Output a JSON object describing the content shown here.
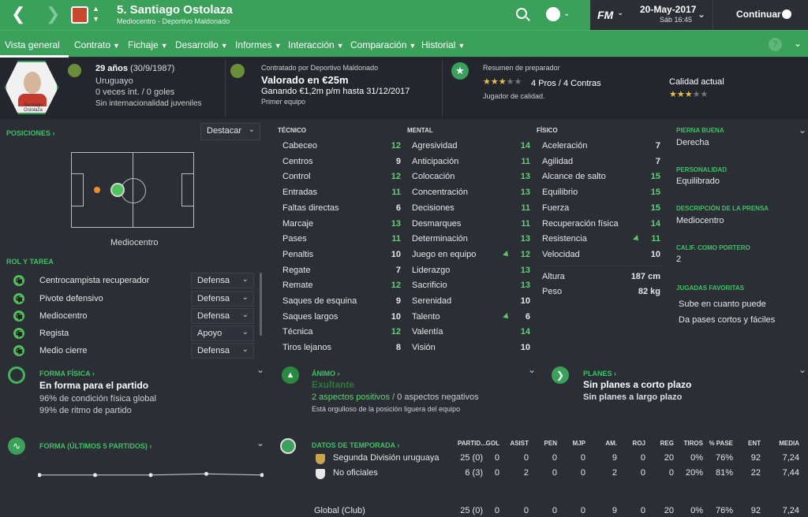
{
  "topbar": {
    "title": "5. Santiago Ostolaza",
    "subtitle": "Mediocentro - Deportivo Maldonado",
    "date": "20-May-2017",
    "day_time": "Sáb 16:45",
    "continue_label": "Continuar",
    "fm_logo": "FM"
  },
  "nav": {
    "items": [
      "Vista general",
      "Contrato",
      "Fichaje",
      "Desarrollo",
      "Informes",
      "Interacción",
      "Comparación",
      "Historial"
    ]
  },
  "profile": {
    "card_name": "Santiago\nOstolaza",
    "age": "29 años",
    "dob": "(30/9/1987)",
    "nationality": "Uruguayo",
    "caps": "0 veces int. / 0 goles",
    "youth": "Sin internacionalidad juveniles"
  },
  "contract": {
    "signed_by": "Contratado por Deportivo Maldonado",
    "value": "Valorado en €25m",
    "wage": "Ganando €1,2m p/m hasta 31/12/2017",
    "squad": "Primer equipo"
  },
  "coach": {
    "title": "Resumen de preparador",
    "pros_cons": "4 Pros / 4 Contras",
    "quality": "Jugador de calidad.",
    "current_quality_label": "Calidad actual",
    "stars_filled": 3,
    "stars_total": 5
  },
  "positions": {
    "label": "POSICIONES",
    "highlight_label": "Destacar",
    "position_name": "Mediocentro"
  },
  "roles": {
    "label": "ROL Y TAREA",
    "items": [
      {
        "role": "Centrocampista recuperador",
        "duty": "Defensa"
      },
      {
        "role": "Pivote defensivo",
        "duty": "Defensa"
      },
      {
        "role": "Mediocentro",
        "duty": "Defensa"
      },
      {
        "role": "Regista",
        "duty": "Apoyo"
      },
      {
        "role": "Medio cierre",
        "duty": "Defensa"
      }
    ]
  },
  "attributes": {
    "technical_label": "TÉCNICO",
    "mental_label": "MENTAL",
    "physical_label": "FÍSICO",
    "technical": [
      {
        "name": "Cabeceo",
        "value": "12",
        "hi": true
      },
      {
        "name": "Centros",
        "value": "9"
      },
      {
        "name": "Control",
        "value": "12",
        "hi": true
      },
      {
        "name": "Entradas",
        "value": "11",
        "hi": true
      },
      {
        "name": "Faltas directas",
        "value": "6"
      },
      {
        "name": "Marcaje",
        "value": "13",
        "hi": true
      },
      {
        "name": "Pases",
        "value": "11",
        "hi": true
      },
      {
        "name": "Penaltis",
        "value": "10"
      },
      {
        "name": "Regate",
        "value": "7"
      },
      {
        "name": "Remate",
        "value": "12",
        "hi": true
      },
      {
        "name": "Saques de esquina",
        "value": "9"
      },
      {
        "name": "Saques largos",
        "value": "10"
      },
      {
        "name": "Técnica",
        "value": "12",
        "hi": true
      },
      {
        "name": "Tiros lejanos",
        "value": "8"
      }
    ],
    "mental": [
      {
        "name": "Agresividad",
        "value": "14",
        "hi": true
      },
      {
        "name": "Anticipación",
        "value": "11",
        "hi": true
      },
      {
        "name": "Colocación",
        "value": "13",
        "hi": true
      },
      {
        "name": "Concentración",
        "value": "13",
        "hi": true
      },
      {
        "name": "Decisiones",
        "value": "11",
        "hi": true
      },
      {
        "name": "Desmarques",
        "value": "11",
        "hi": true
      },
      {
        "name": "Determinación",
        "value": "13",
        "hi": true
      },
      {
        "name": "Juego en equipo",
        "value": "12",
        "hi": true,
        "arrow": true
      },
      {
        "name": "Liderazgo",
        "value": "13",
        "hi": true
      },
      {
        "name": "Sacrificio",
        "value": "13",
        "hi": true
      },
      {
        "name": "Serenidad",
        "value": "10"
      },
      {
        "name": "Talento",
        "value": "6",
        "arrow": true
      },
      {
        "name": "Valentía",
        "value": "14",
        "hi": true
      },
      {
        "name": "Visión",
        "value": "10"
      }
    ],
    "physical": [
      {
        "name": "Aceleración",
        "value": "7"
      },
      {
        "name": "Agilidad",
        "value": "7"
      },
      {
        "name": "Alcance de salto",
        "value": "15",
        "hi": true
      },
      {
        "name": "Equilibrio",
        "value": "15",
        "hi": true
      },
      {
        "name": "Fuerza",
        "value": "15",
        "hi": true
      },
      {
        "name": "Recuperación física",
        "value": "14",
        "hi": true
      },
      {
        "name": "Resistencia",
        "value": "11",
        "hi": true,
        "arrow": true
      },
      {
        "name": "Velocidad",
        "value": "10"
      }
    ],
    "height_label": "Altura",
    "height": "187 cm",
    "weight_label": "Peso",
    "weight": "82 kg"
  },
  "side": {
    "foot_label": "PIERNA BUENA",
    "foot": "Derecha",
    "personality_label": "PERSONALIDAD",
    "personality": "Equilibrado",
    "press_label": "DESCRIPCIÓN DE LA PRENSA",
    "press": "Mediocentro",
    "gk_label": "CALIF. COMO PORTERO",
    "gk": "2",
    "moves_label": "JUGADAS FAVORITAS",
    "moves": [
      "Sube en cuanto puede",
      "Da pases cortos y fáciles"
    ]
  },
  "fitness": {
    "label": "FORMA FÍSICA",
    "status": "En forma para el partido",
    "condition": "96% de condición física global",
    "sharpness": "99% de ritmo de partido"
  },
  "morale": {
    "label": "ÁNIMO",
    "status": "Exultante",
    "positive": "2 aspectos positivos",
    "negative": "0 aspectos negativos",
    "note": "Está orgulloso de la posición liguera del equipo"
  },
  "plans": {
    "label": "PLANES",
    "short": "Sin planes a corto plazo",
    "long": "Sin planes a largo plazo"
  },
  "form": {
    "label": "FORMA (ÚLTIMOS 5 PARTIDOS)",
    "values": [
      7.2,
      7.2,
      7.2,
      7.3,
      7.2
    ]
  },
  "season": {
    "label": "DATOS DE TEMPORADA",
    "headers": [
      "PARTID...",
      "GOL",
      "ASIST",
      "PEN",
      "MJP",
      "AM.",
      "ROJ",
      "REG",
      "TIROS",
      "% PASE",
      "ENT",
      "MEDIA"
    ],
    "rows": [
      {
        "name": "Segunda División uruguaya",
        "cells": [
          "25 (0)",
          "0",
          "0",
          "0",
          "0",
          "9",
          "0",
          "20",
          "0%",
          "76%",
          "92",
          "7,24"
        ]
      },
      {
        "name": "No oficiales",
        "cells": [
          "6 (3)",
          "0",
          "2",
          "0",
          "0",
          "2",
          "0",
          "0",
          "20%",
          "81%",
          "22",
          "7,44"
        ]
      }
    ],
    "total": {
      "name": "Global (Club)",
      "cells": [
        "25 (0)",
        "0",
        "0",
        "0",
        "0",
        "9",
        "0",
        "20",
        "0%",
        "76%",
        "92",
        "7,24"
      ]
    }
  },
  "colors": {
    "accent": "#3aa05a",
    "panel": "#2b2e35",
    "green_value": "#61d074"
  }
}
